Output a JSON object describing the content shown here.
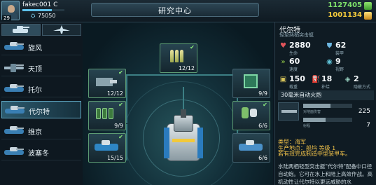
{
  "player": {
    "level": "29",
    "name": "fakec001 C",
    "power": "75050",
    "xp_fraction": 0.7
  },
  "screen_title": "研究中心",
  "resources": [
    {
      "value": "1127405",
      "icon": "green-resource-icon",
      "color": "#7ee06a"
    },
    {
      "value": "1001134",
      "icon": "gold-resource-icon",
      "color": "#f5cc3b"
    }
  ],
  "tabs": [
    "tank-tab",
    "aircraft-tab"
  ],
  "vehicle_list": [
    {
      "name": "旋风",
      "icon": "tank"
    },
    {
      "name": "天顶",
      "icon": "jet"
    },
    {
      "name": "托尔",
      "icon": "tank"
    },
    {
      "name": "代尔特",
      "icon": "tank",
      "selected": true
    },
    {
      "name": "维京",
      "icon": "tank"
    },
    {
      "name": "波塞冬",
      "icon": "tank"
    }
  ],
  "research_nodes": [
    {
      "id": "top",
      "count": "12/12",
      "done": true
    },
    {
      "id": "mid-left",
      "count": "12/12",
      "done": true
    },
    {
      "id": "mid-right",
      "count": "9/9",
      "done": false
    },
    {
      "id": "low-left",
      "count": "9/9",
      "done": true
    },
    {
      "id": "low-right",
      "count": "6/6",
      "done": true
    },
    {
      "id": "bottom-left",
      "count": "15/15",
      "done": true
    },
    {
      "id": "bottom-right",
      "count": "6/6",
      "done": false
    }
  ],
  "info": {
    "name": "代尔特",
    "subtitle": "轻型两栖突击艇",
    "stats": [
      {
        "value": "2880",
        "label": "生命",
        "icon": "heart-icon",
        "color": "#e0545a"
      },
      {
        "value": "62",
        "label": "装甲",
        "icon": "shield-icon",
        "color": "#6cb6e0"
      },
      {
        "value": "60",
        "label": "速度",
        "icon": "speed-icon",
        "color": "#9ad34a"
      },
      {
        "value": "9",
        "label": "视野",
        "icon": "eye-icon",
        "color": "#5fc3d8"
      },
      {
        "value": "150",
        "label": "载重",
        "icon": "cargo-icon",
        "color": "#d6c35a"
      },
      {
        "value": "18",
        "label": "补给",
        "icon": "supply-icon",
        "color": "#7fa4c2"
      },
      {
        "value": "2",
        "label": "隐蔽方式",
        "icon": "stealth-icon",
        "color": "#9ad3c2"
      }
    ],
    "weapon": {
      "name": "30毫米自动火炮",
      "bars": [
        {
          "label": "对地面伤害",
          "value": "225",
          "fill": 0.55
        },
        {
          "label": "射程",
          "value": "7",
          "fill": 0.45
        }
      ]
    },
    "type_line": "类型：海军",
    "production_line": "生产地点：船坞 等级 1",
    "note_line": "若有效完成制造中型装甲车。",
    "description": "水陆两栖轻型突击艇\"代尔特\"配备中口径自动炮。它可在水上和陆上高效作战。高机动性让代尔特以更远威胁的水"
  }
}
